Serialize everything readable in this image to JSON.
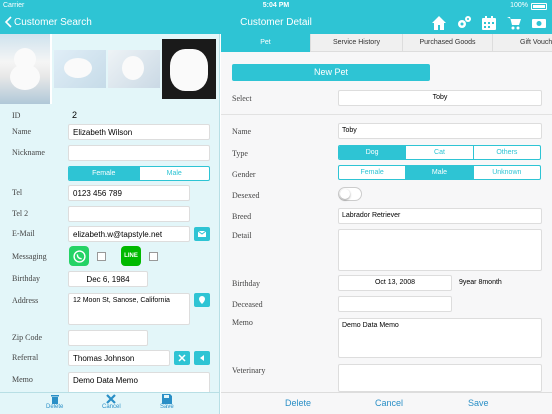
{
  "status_bar": {
    "carrier": "Carrier",
    "time": "5:04 PM",
    "battery": "100%"
  },
  "nav": {
    "back_label": "Customer Search",
    "title": "Customer Detail",
    "icons": [
      "home-icon",
      "settings-icon",
      "calendar-icon",
      "cart-icon",
      "cash-icon"
    ]
  },
  "customer": {
    "labels": {
      "id": "ID",
      "name": "Name",
      "nickname": "Nickname",
      "tel": "Tel",
      "tel2": "Tel 2",
      "email": "E-Mail",
      "messaging": "Messaging",
      "birthday": "Birthday",
      "address": "Address",
      "zip": "Zip Code",
      "referral": "Referral",
      "memo": "Memo"
    },
    "id": "2",
    "name": "Elizabeth Wilson",
    "nickname": "",
    "gender_options": [
      "Female",
      "Male"
    ],
    "gender_selected": "Female",
    "tel": "0123 456 789",
    "tel2": "",
    "email": "elizabeth.w@tapstyle.net",
    "birthday": "Dec 6, 1984",
    "address": "12 Moon St, Sanose, California",
    "zip": "",
    "referral": "Thomas Johnson",
    "memo": "Demo Data Memo",
    "messaging_apps": [
      "WhatsApp",
      "LINE"
    ]
  },
  "left_toolbar": {
    "delete": "Delete",
    "cancel": "Cancel",
    "save": "Save"
  },
  "tabs": [
    "Pet",
    "Service History",
    "Purchased Goods",
    "Gift Vouch"
  ],
  "tab_selected": "Pet",
  "pet": {
    "new_pet_label": "New Pet",
    "labels": {
      "select": "Select",
      "name": "Name",
      "type": "Type",
      "gender": "Gender",
      "desexed": "Desexed",
      "breed": "Breed",
      "detail": "Detail",
      "birthday": "Birthday",
      "deceased": "Deceased",
      "memo": "Memo",
      "veterinary": "Veterinary"
    },
    "select_value": "Toby",
    "name": "Toby",
    "type_options": [
      "Dog",
      "Cat",
      "Others"
    ],
    "type_selected": "Dog",
    "gender_options": [
      "Female",
      "Male",
      "Unknown"
    ],
    "gender_selected": "Male",
    "desexed": false,
    "breed": "Labrador Retriever",
    "detail": "",
    "birthday": "Oct 13, 2008",
    "age": "9year 8month",
    "deceased": "",
    "memo": "Demo Data Memo",
    "veterinary": ""
  },
  "right_toolbar": {
    "delete": "Delete",
    "cancel": "Cancel",
    "save": "Save"
  },
  "colors": {
    "accent": "#2ec4d4",
    "link": "#2a8fc6",
    "left_bg": "#e3f6f9",
    "whatsapp": "#25d366",
    "line": "#00b900"
  }
}
